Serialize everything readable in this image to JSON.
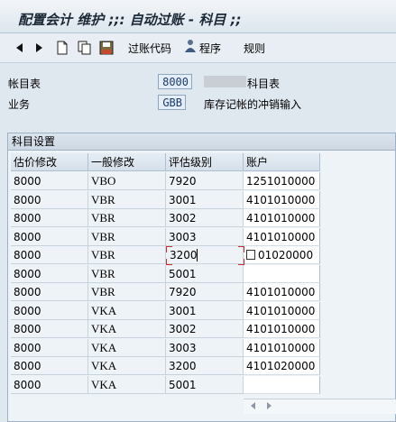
{
  "window": {
    "title": "配置会计 维护 ;;: 自动过账 - 科目 ;;"
  },
  "toolbar": {
    "posting_code_label": "过账代码",
    "procedure_label": "程序",
    "rules_label": "规则"
  },
  "header": {
    "chart_label": "帐目表",
    "chart_value": "8000",
    "chart_suffix": "科目表",
    "business_label": "业务",
    "business_value": "GBB",
    "business_desc": "库存记帐的冲销输入"
  },
  "section": {
    "title": "科目设置"
  },
  "table": {
    "columns": [
      "估价修改",
      "一般修改",
      "评估级别",
      "账户"
    ],
    "rows": [
      [
        "8000",
        "VBO",
        "7920",
        "1251010000"
      ],
      [
        "8000",
        "VBR",
        "3001",
        "4101010000"
      ],
      [
        "8000",
        "VBR",
        "3002",
        "4101010000"
      ],
      [
        "8000",
        "VBR",
        "3003",
        "4101010000"
      ],
      [
        "8000",
        "VBR",
        "3200",
        "01020000"
      ],
      [
        "8000",
        "VBR",
        "5001",
        ""
      ],
      [
        "8000",
        "VBR",
        "7920",
        "4101010000"
      ],
      [
        "8000",
        "VKA",
        "3001",
        "4101010000"
      ],
      [
        "8000",
        "VKA",
        "3002",
        "4101010000"
      ],
      [
        "8000",
        "VKA",
        "3003",
        "4101010000"
      ],
      [
        "8000",
        "VKA",
        "3200",
        "4101020000"
      ],
      [
        "8000",
        "VKA",
        "5001",
        ""
      ]
    ]
  },
  "colors": {
    "accent": "#1a3a6b",
    "focus": "#d12c2c"
  },
  "icons": [
    "back-arrow-icon",
    "forward-arrow-icon",
    "new-document-icon",
    "copy-icon",
    "save-icon",
    "procedure-person-icon",
    "left-arrow-icon",
    "right-arrow-icon"
  ]
}
